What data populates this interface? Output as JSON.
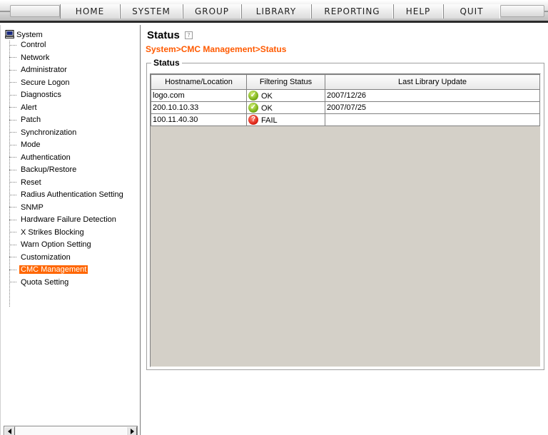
{
  "menu": {
    "items": [
      {
        "label": "HOME"
      },
      {
        "label": "SYSTEM"
      },
      {
        "label": "GROUP"
      },
      {
        "label": "LIBRARY"
      },
      {
        "label": "REPORTING"
      },
      {
        "label": "HELP"
      },
      {
        "label": "QUIT"
      }
    ]
  },
  "sidebar": {
    "root_label": "System",
    "root_icon": "computer-icon",
    "items": [
      {
        "label": "Control"
      },
      {
        "label": "Network"
      },
      {
        "label": "Administrator"
      },
      {
        "label": "Secure Logon"
      },
      {
        "label": "Diagnostics"
      },
      {
        "label": "Alert"
      },
      {
        "label": "Patch"
      },
      {
        "label": "Synchronization"
      },
      {
        "label": "Mode"
      },
      {
        "label": "Authentication"
      },
      {
        "label": "Backup/Restore"
      },
      {
        "label": "Reset"
      },
      {
        "label": "Radius Authentication Setting"
      },
      {
        "label": "SNMP"
      },
      {
        "label": "Hardware Failure Detection"
      },
      {
        "label": "X Strikes Blocking"
      },
      {
        "label": "Warn Option Setting"
      },
      {
        "label": "Customization"
      },
      {
        "label": "CMC Management",
        "selected": true
      },
      {
        "label": "Quota Setting"
      }
    ]
  },
  "main": {
    "title": "Status",
    "help_icon": "help-icon",
    "breadcrumb": "System>CMC Management>Status",
    "group_label": "Status",
    "table": {
      "columns": [
        "Hostname/Location",
        "Filtering Status",
        "Last Library Update"
      ],
      "rows": [
        {
          "host": "logo.com",
          "status": "OK",
          "status_icon": "ok-check-icon",
          "updated": "2007/12/26"
        },
        {
          "host": "200.10.10.33",
          "status": "OK",
          "status_icon": "ok-check-icon",
          "updated": "2007/07/25"
        },
        {
          "host": "100.11.40.30",
          "status": "FAIL",
          "status_icon": "fail-icon",
          "updated": ""
        }
      ]
    }
  },
  "colors": {
    "accent": "#ff6600",
    "breadcrumb": "#ff5a00",
    "ok": "#7cb21b",
    "fail": "#e0281a",
    "grid_bg": "#d4d0c8"
  }
}
